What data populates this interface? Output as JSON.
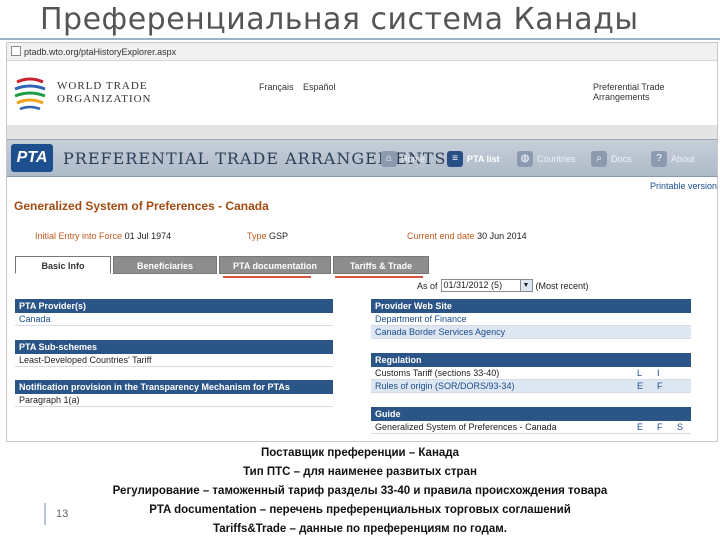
{
  "slide": {
    "title": "Преференциальная система Канады",
    "page_number": "13"
  },
  "browser": {
    "url": "ptadb.wto.org/ptaHistoryExplorer.aspx"
  },
  "wto_header": {
    "org_name_line1": "World Trade",
    "org_name_line2": "Organization",
    "lang_fr": "Français",
    "lang_es": "Español",
    "pta_link": "Preferential Trade Arrangements"
  },
  "pta_banner": {
    "logo": "PTA",
    "title": "Preferential Trade Arrangements",
    "nav": [
      {
        "label": "Home",
        "icon": "home-icon",
        "glyph": "⌂",
        "active": false
      },
      {
        "label": "PTA list",
        "icon": "list-icon",
        "glyph": "≡",
        "active": true
      },
      {
        "label": "Countries",
        "icon": "globe-icon",
        "glyph": "◍",
        "active": false
      },
      {
        "label": "Docs",
        "icon": "search-icon",
        "glyph": "⌕",
        "active": false
      },
      {
        "label": "About",
        "icon": "help-icon",
        "glyph": "?",
        "active": false
      }
    ]
  },
  "page": {
    "printable": "Printable version",
    "title": "Generalized System of Preferences - Canada",
    "entry_label": "Initial Entry into Force",
    "entry_value": "01 Jul 1974",
    "type_label": "Type",
    "type_value": "GSP",
    "end_label": "Current end date",
    "end_value": "30 Jun 2014"
  },
  "tabs": [
    {
      "label": "Basic Info",
      "active": true
    },
    {
      "label": "Beneficiaries",
      "active": false
    },
    {
      "label": "PTA documentation",
      "active": false
    },
    {
      "label": "Tariffs & Trade",
      "active": false
    }
  ],
  "as_of": {
    "label": "As of",
    "value": "01/31/2012 (5)",
    "note": "(Most recent)"
  },
  "left_panels": {
    "provider_head": "PTA Provider(s)",
    "provider_value": "Canada",
    "subschemes_head": "PTA Sub-schemes",
    "subschemes_value": "Least-Developed Countries' Tariff",
    "notification_head": "Notification provision in the Transparency Mechanism for PTAs",
    "notification_value": "Paragraph 1(a)"
  },
  "right_panels": {
    "web_head": "Provider Web Site",
    "web_1": "Department of Finance",
    "web_2": "Canada Border Services Agency",
    "regulation_head": "Regulation",
    "reg_1": "Customs Tariff (sections 33-40)",
    "reg_1_c1": "L",
    "reg_1_c2": "I",
    "reg_2": "Rules of origin (SOR/DORS/93-34)",
    "reg_2_c1": "E",
    "reg_2_c2": "F",
    "guide_head": "Guide",
    "guide_1": "Generalized System of Preferences - Canada",
    "guide_c1": "E",
    "guide_c2": "F",
    "guide_c3": "S"
  },
  "caption": {
    "line1": "Поставщик преференции – Канада",
    "line2": "Тип ПТС – для наименее развитых стран",
    "line3": "Регулирование – таможенный тариф разделы 33-40 и правила происхождения товара",
    "line4": "PTA documentation – перечень преференциальных торговых соглашений",
    "line5": "Tariffs&Trade – данные по преференциям по годам."
  },
  "colors": {
    "panel_header": "#2b5587",
    "title_orange": "#a44b12",
    "accent_red": "#d8553b"
  }
}
